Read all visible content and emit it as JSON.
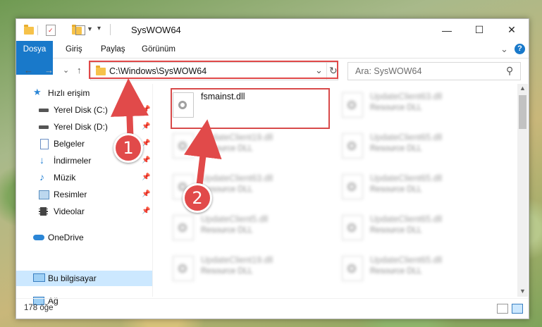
{
  "window": {
    "title": "SysWOW64",
    "minimize": "—",
    "maximize": "☐",
    "close": "✕"
  },
  "ribbon": {
    "tabs": [
      "Dosya",
      "Giriş",
      "Paylaş",
      "Görünüm"
    ],
    "collapse": "⌄",
    "help": "?"
  },
  "address": {
    "path": "C:\\Windows\\SysWOW64",
    "dropdown": "⌄",
    "refresh": "↻"
  },
  "search": {
    "placeholder": "Ara: SysWOW64",
    "icon": "⚲"
  },
  "nav_buttons": {
    "back": "←",
    "forward": "→",
    "recent": "⌄",
    "up": "↑"
  },
  "sidebar": {
    "items": [
      {
        "label": "Hızlı erişim",
        "icon": "star-icon"
      },
      {
        "label": "Yerel Disk (C:)",
        "icon": "drive-icon",
        "pinned": true
      },
      {
        "label": "Yerel Disk (D:)",
        "icon": "drive-icon",
        "pinned": true
      },
      {
        "label": "Belgeler",
        "icon": "document-icon",
        "pinned": true
      },
      {
        "label": "İndirmeler",
        "icon": "download-icon",
        "pinned": true
      },
      {
        "label": "Müzik",
        "icon": "music-icon",
        "pinned": true
      },
      {
        "label": "Resimler",
        "icon": "pictures-icon",
        "pinned": true
      },
      {
        "label": "Videolar",
        "icon": "video-icon",
        "pinned": true
      },
      {
        "label": "OneDrive",
        "icon": "cloud-icon"
      },
      {
        "label": "Bu bilgisayar",
        "icon": "computer-icon",
        "selected": true
      },
      {
        "label": "Ağ",
        "icon": "network-icon"
      }
    ],
    "pin_glyph": "📌"
  },
  "files": [
    {
      "name": "fsmainst.dll",
      "type": ""
    },
    {
      "name": "UpdateClient63.dll",
      "type": "Resource DLL"
    },
    {
      "name": "UpdateClient19.dll",
      "type": "Resource DLL"
    },
    {
      "name": "UpdateClient65.dll",
      "type": "Resource DLL"
    },
    {
      "name": "UpdateClient63.dll",
      "type": "Resource DLL"
    },
    {
      "name": "UpdateClient65.dll",
      "type": "Resource DLL"
    },
    {
      "name": "UpdateClient5.dll",
      "type": "Resource DLL"
    },
    {
      "name": "UpdateClient65.dll",
      "type": "Resource DLL"
    },
    {
      "name": "UpdateClient19.dll",
      "type": "Resource DLL"
    },
    {
      "name": "UpdateClient65.dll",
      "type": "Resource DLL"
    }
  ],
  "status": {
    "count": "178 öğe"
  },
  "annotations": {
    "step1": "1",
    "step2": "2",
    "color": "#e14a4a"
  }
}
